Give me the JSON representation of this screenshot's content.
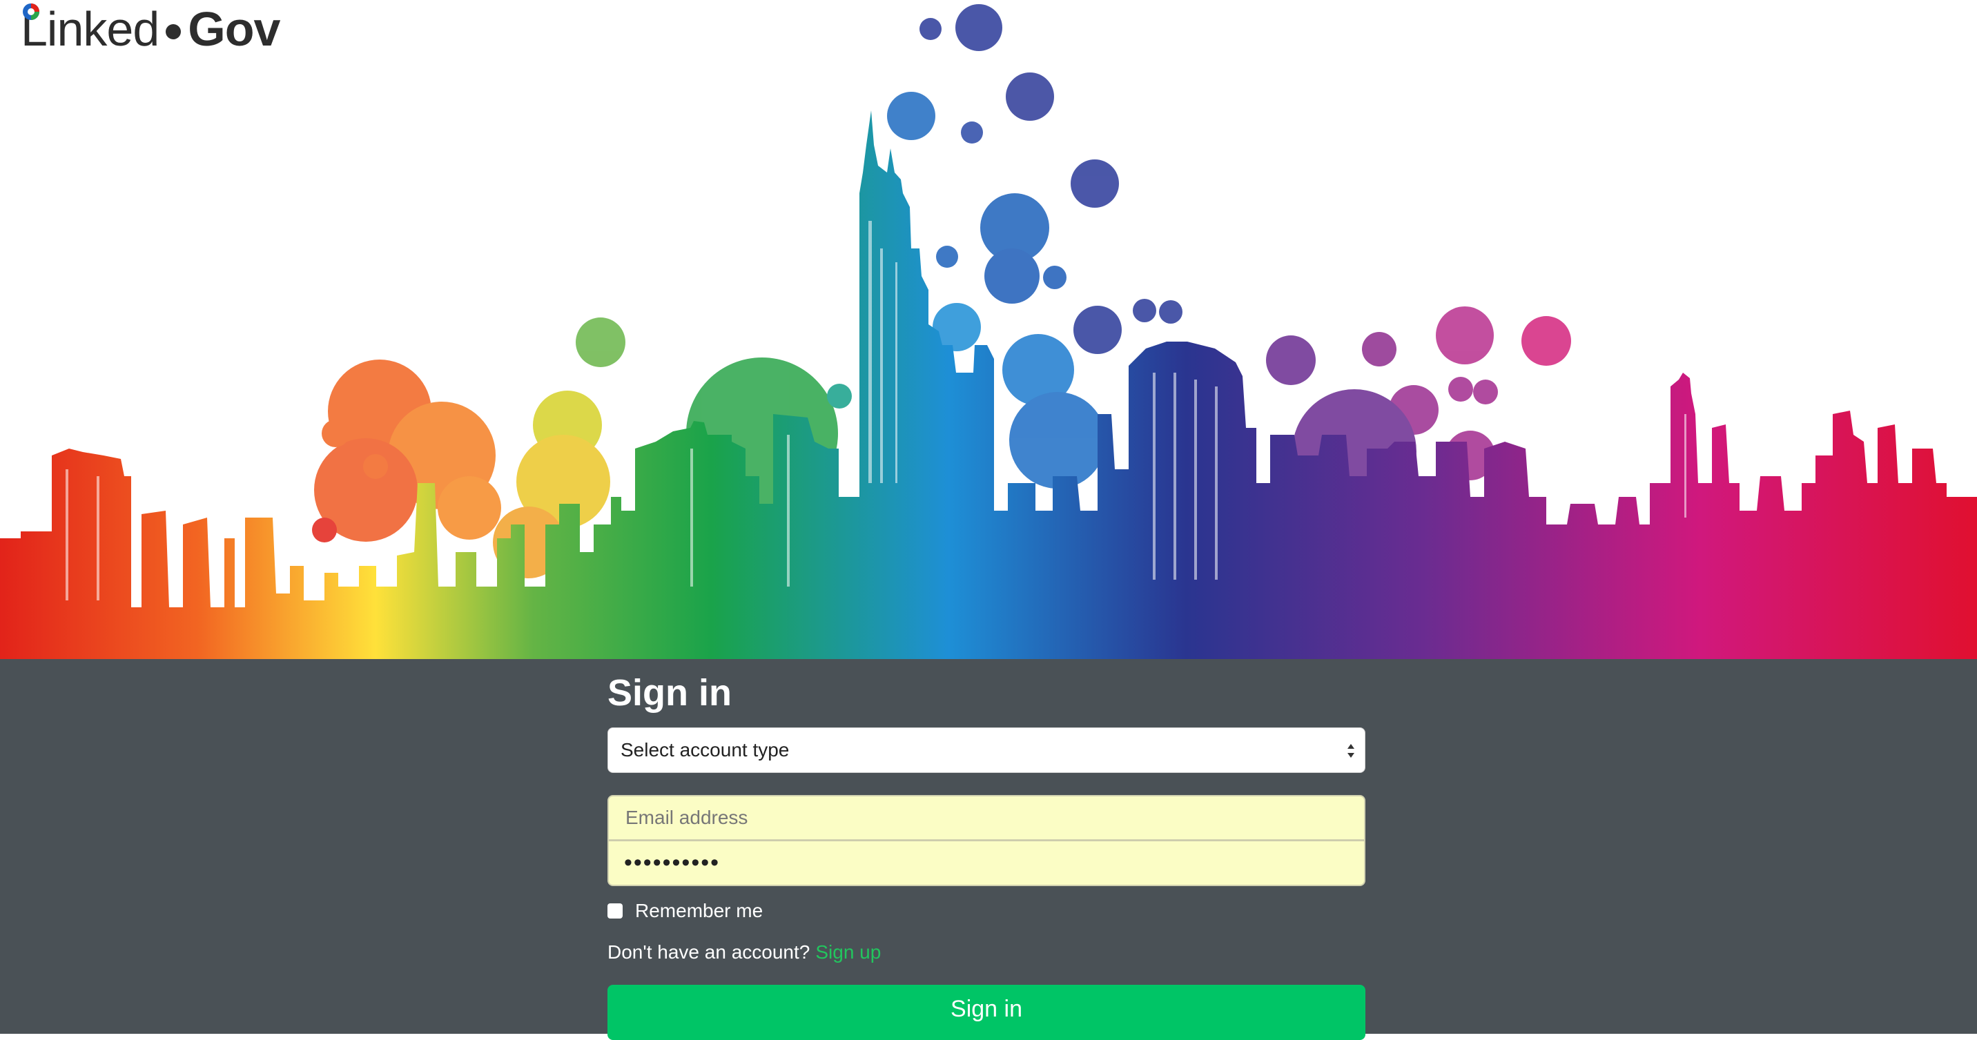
{
  "brand": {
    "name_part1": "Linked",
    "name_part2": "Gov"
  },
  "signin": {
    "title": "Sign in",
    "account_select": {
      "selected": "Select account type"
    },
    "email": {
      "placeholder": "Email address",
      "value": ""
    },
    "password": {
      "masked_value": "••••••••••"
    },
    "remember_label": "Remember me",
    "signup_prompt": "Don't have an account?",
    "signup_link": "Sign up",
    "submit_label": "Sign in"
  },
  "colors": {
    "panel_bg": "#4a5156",
    "submit_bg": "#00c566",
    "link": "#22c55e",
    "autofill_bg": "#fbfdc5"
  }
}
